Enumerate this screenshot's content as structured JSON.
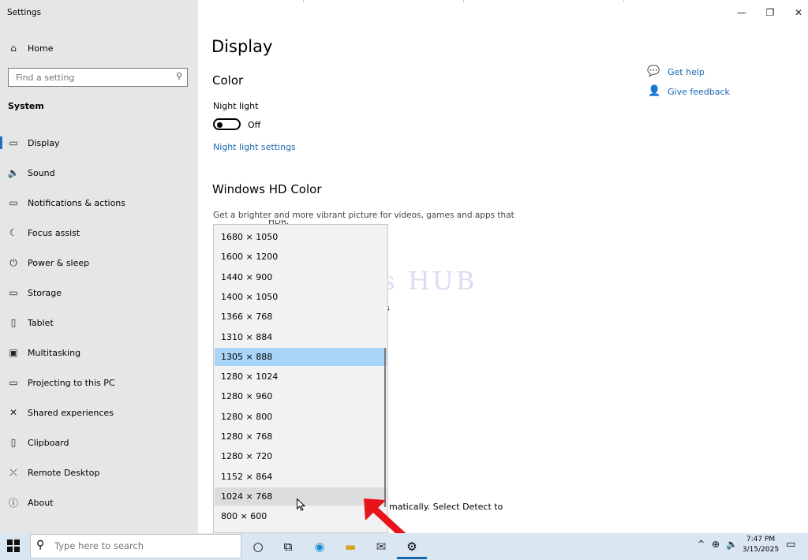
{
  "window": {
    "title": "Settings"
  },
  "sidebar": {
    "home_label": "Home",
    "search_placeholder": "Find a setting",
    "section_label": "System",
    "items": [
      {
        "label": "Display",
        "icon": "monitor-icon"
      },
      {
        "label": "Sound",
        "icon": "speaker-icon"
      },
      {
        "label": "Notifications & actions",
        "icon": "notification-icon"
      },
      {
        "label": "Focus assist",
        "icon": "moon-icon"
      },
      {
        "label": "Power & sleep",
        "icon": "power-icon"
      },
      {
        "label": "Storage",
        "icon": "storage-icon"
      },
      {
        "label": "Tablet",
        "icon": "tablet-icon"
      },
      {
        "label": "Multitasking",
        "icon": "multitasking-icon"
      },
      {
        "label": "Projecting to this PC",
        "icon": "projecting-icon"
      },
      {
        "label": "Shared experiences",
        "icon": "shared-icon"
      },
      {
        "label": "Clipboard",
        "icon": "clipboard-icon"
      },
      {
        "label": "Remote Desktop",
        "icon": "remote-desktop-icon"
      },
      {
        "label": "About",
        "icon": "info-icon"
      }
    ]
  },
  "main": {
    "title": "Display",
    "color_heading": "Color",
    "night_light_label": "Night light",
    "night_light_state": "Off",
    "night_light_settings_link": "Night light settings",
    "hd_color_heading": "Windows HD Color",
    "hd_color_description": "Get a brighter and more vibrant picture for videos, games and apps that",
    "hd_color_description_tail": "HDR.",
    "partial_text_s": "s",
    "detect_text_fragment": "matically. Select Detect to"
  },
  "help": {
    "get_help": "Get help",
    "give_feedback": "Give feedback"
  },
  "resolution_dropdown": {
    "options": [
      "1680 × 1050",
      "1600 × 1200",
      "1440 × 900",
      "1400 × 1050",
      "1366 × 768",
      "1310 × 884",
      "1305 × 888",
      "1280 × 1024",
      "1280 × 960",
      "1280 × 800",
      "1280 × 768",
      "1280 × 720",
      "1152 × 864",
      "1024 × 768",
      "800 × 600"
    ],
    "selected": "1305 × 888",
    "hovered": "1024 × 768"
  },
  "watermark": "IT Pros HUB",
  "taskbar": {
    "search_placeholder": "Type here to search",
    "time": "7:47 PM",
    "date": "3/15/2025"
  },
  "colors": {
    "accent": "#1a66b0",
    "selected_option": "#a8d5f7",
    "arrow": "#e8141b"
  }
}
